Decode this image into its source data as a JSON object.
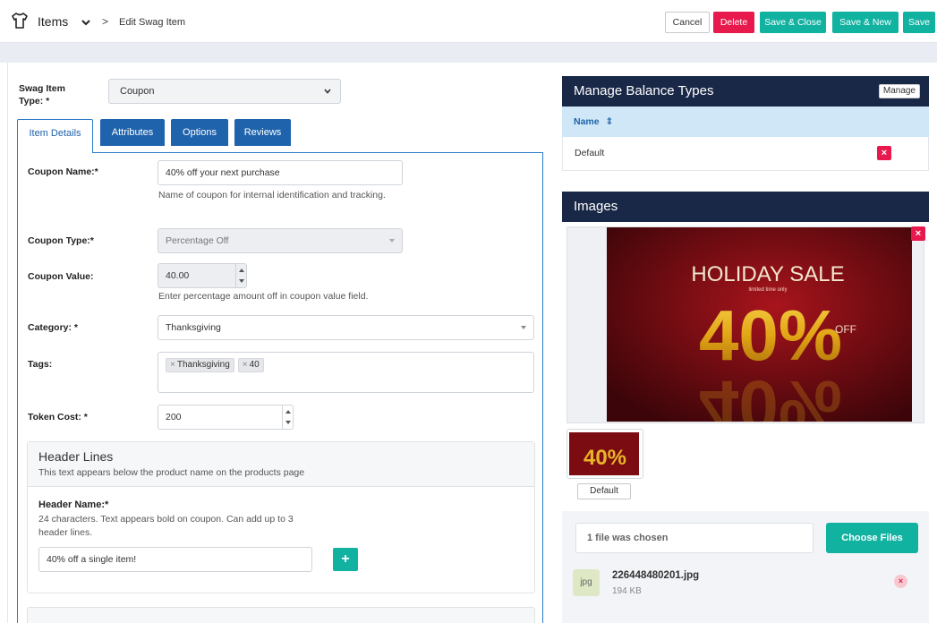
{
  "header": {
    "root": "Items",
    "separator": ">",
    "current": "Edit Swag Item",
    "buttons": {
      "cancel": "Cancel",
      "delete": "Delete",
      "save_close": "Save & Close",
      "save_new": "Save & New",
      "save": "Save"
    }
  },
  "form": {
    "type_label": "Swag Item Type: *",
    "type_value": "Coupon",
    "tabs": [
      "Item Details",
      "Attributes",
      "Options",
      "Reviews"
    ],
    "coupon_name": {
      "label": "Coupon Name:*",
      "value": "40% off your next purchase",
      "help": "Name of coupon for internal identification and tracking."
    },
    "coupon_type": {
      "label": "Coupon Type:*",
      "value": "Percentage Off"
    },
    "coupon_value": {
      "label": "Coupon Value:",
      "value": "40.00",
      "help": "Enter percentage amount off in coupon value field."
    },
    "category": {
      "label": "Category: *",
      "value": "Thanksgiving"
    },
    "tags": {
      "label": "Tags:",
      "items": [
        "Thanksgiving",
        "40"
      ]
    },
    "token_cost": {
      "label": "Token Cost: *",
      "value": "200"
    },
    "header_lines": {
      "title": "Header Lines",
      "subtitle": "This text appears below the product name on the products page",
      "name_label": "Header Name:*",
      "name_help": "24 characters. Text appears bold on coupon. Can add up to 3 header lines.",
      "name_value": "40% off a single item!",
      "add_label": "+"
    }
  },
  "balance": {
    "title": "Manage Balance Types",
    "manage_label": "Manage",
    "column": "Name",
    "sort_icon": "⇕",
    "rows": [
      "Default"
    ]
  },
  "images": {
    "title": "Images",
    "hero_text": {
      "line1": "HOLIDAY SALE",
      "line2": "limited time only",
      "big": "40%",
      "off": "OFF"
    },
    "thumb_label": "Default",
    "file_input_text": "1 file was chosen",
    "choose_label": "Choose Files",
    "file": {
      "ext": "jpg",
      "name": "226448480201.jpg",
      "size": "194 KB"
    }
  },
  "colors": {
    "teal": "#12b2a1",
    "red": "#e8194d",
    "navy": "#192847",
    "blue": "#1f63ad"
  }
}
